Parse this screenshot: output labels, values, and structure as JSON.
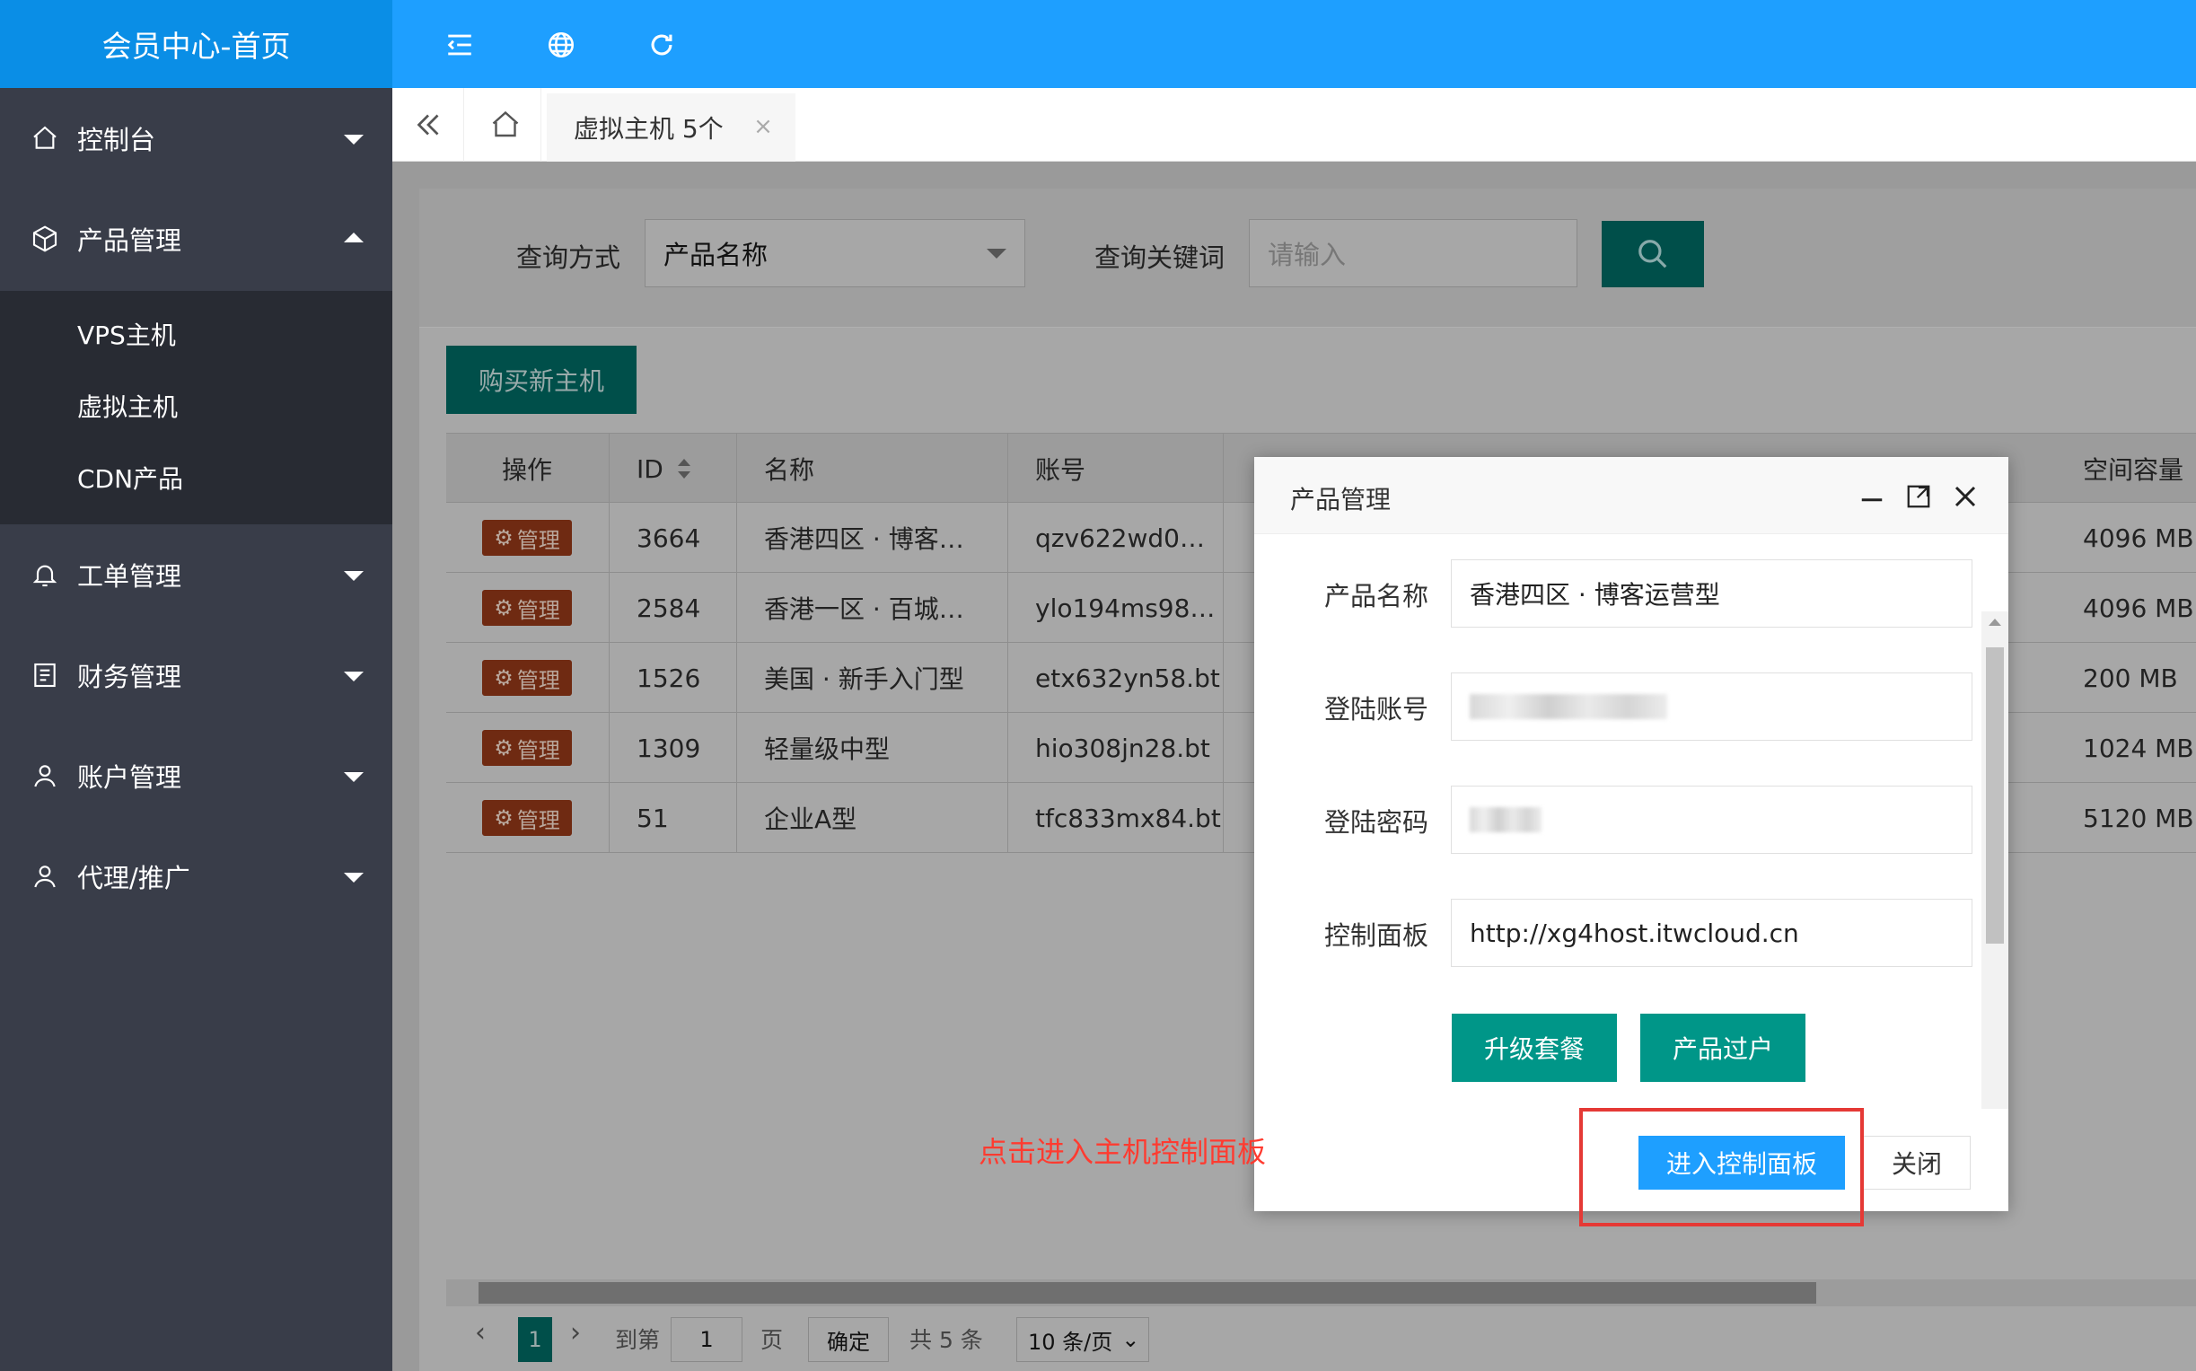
{
  "header": {
    "logo": "会员中心-首页",
    "icons": [
      "menu-fold-icon",
      "globe-icon",
      "refresh-icon"
    ]
  },
  "sidebar": {
    "items": [
      {
        "label": "控制台",
        "icon": "home-icon"
      },
      {
        "label": "产品管理",
        "icon": "cube-icon"
      },
      {
        "label": "工单管理",
        "icon": "bell-icon"
      },
      {
        "label": "财务管理",
        "icon": "ledger-icon"
      },
      {
        "label": "账户管理",
        "icon": "user-icon"
      },
      {
        "label": "代理/推广",
        "icon": "user-icon"
      }
    ],
    "subitems": [
      "VPS主机",
      "虚拟主机",
      "CDN产品"
    ]
  },
  "tabs": {
    "active_label": "虚拟主机 5个",
    "close": "×"
  },
  "search": {
    "mode_label": "查询方式",
    "mode_value": "产品名称",
    "keyword_label": "查询关键词",
    "keyword_placeholder": "请输入"
  },
  "buy_button": "购买新主机",
  "table": {
    "headers": {
      "op": "操作",
      "id": "ID",
      "name": "名称",
      "account": "账号",
      "capacity": "空间容量"
    },
    "manage_label": "管理",
    "rows": [
      {
        "id": "3664",
        "name": "香港四区 · 博客…",
        "account": "qzv622wd0…",
        "capacity": "4096 MB"
      },
      {
        "id": "2584",
        "name": "香港一区 · 百城…",
        "account": "ylo194ms98…",
        "capacity": "4096 MB"
      },
      {
        "id": "1526",
        "name": "美国 · 新手入门型",
        "account": "etx632yn58.bt",
        "capacity": "200 MB"
      },
      {
        "id": "1309",
        "name": "轻量级中型",
        "account": "hio308jn28.bt",
        "capacity": "1024 MB"
      },
      {
        "id": "51",
        "name": "企业A型",
        "account": "tfc833mx84.bt",
        "capacity": "5120 MB"
      }
    ]
  },
  "pager": {
    "current": "1",
    "goto_label": "到第",
    "goto_value": "1",
    "page_label": "页",
    "confirm": "确定",
    "total": "共 5 条",
    "per_page": "10 条/页"
  },
  "modal": {
    "title": "产品管理",
    "fields": [
      {
        "label": "产品名称",
        "value": "香港四区 · 博客运营型"
      },
      {
        "label": "登陆账号",
        "value": ""
      },
      {
        "label": "登陆密码",
        "value": ""
      },
      {
        "label": "控制面板",
        "value": "http://xg4host.itwcloud.cn"
      }
    ],
    "upgrade_button": "升级套餐",
    "transfer_button": "产品过户",
    "enter_button": "进入控制面板",
    "close_button": "关闭"
  },
  "annotation": "点击进入主机控制面板",
  "colors": {
    "header": "#1e9fff",
    "sidebar": "#393d49",
    "teal": "#009688",
    "danger": "#ff5722",
    "annotation": "#ff3b30"
  }
}
